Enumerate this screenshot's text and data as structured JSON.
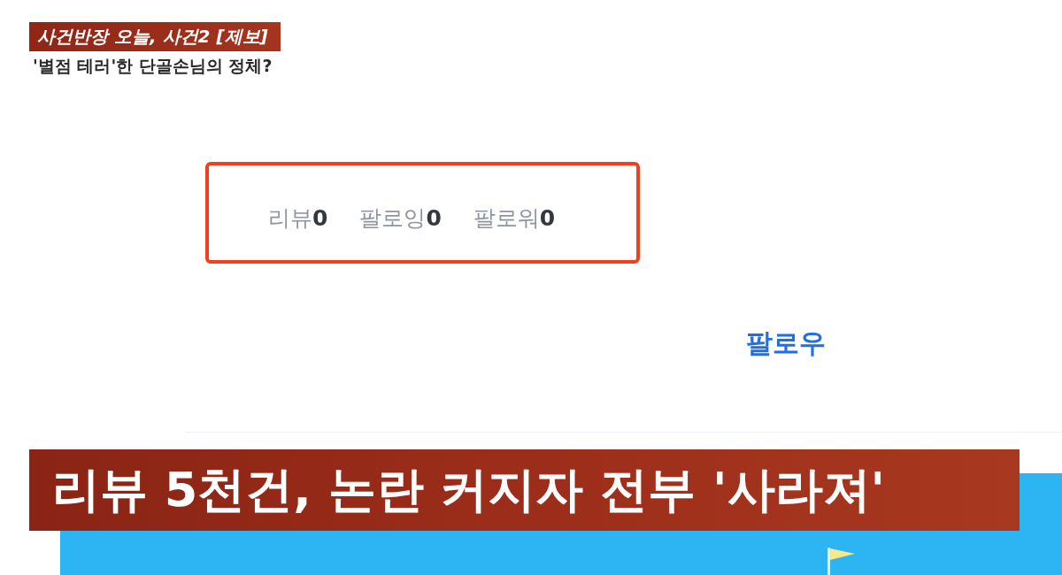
{
  "program_caption": {
    "title": "사건반장 오늘, 사건2 [제보]",
    "subtitle": "'별점 테러'한 단골손님의 정체?"
  },
  "profile_stats": [
    {
      "label": "리뷰",
      "value": "0"
    },
    {
      "label": "팔로잉",
      "value": "0"
    },
    {
      "label": "팔로워",
      "value": "0"
    }
  ],
  "follow_button": {
    "label": "팔로우"
  },
  "headline": "리뷰 5천건, 논란 커지자 전부 '사라져'"
}
